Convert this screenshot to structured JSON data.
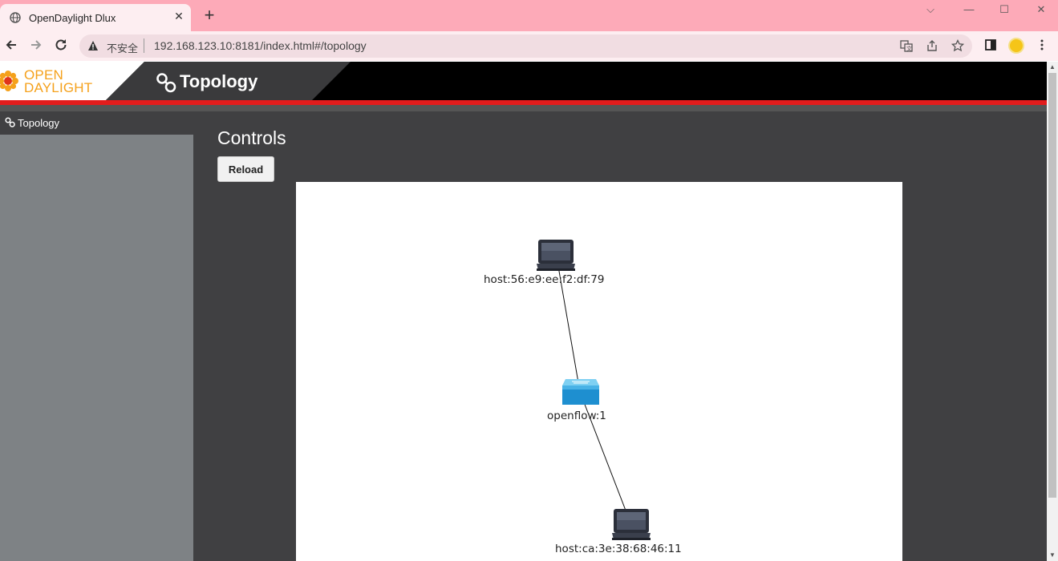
{
  "browser": {
    "tab_title": "OpenDaylight Dlux",
    "tab_close": "✕",
    "new_tab": "+",
    "insecure_label": "不安全",
    "url": "192.168.123.10:8181/index.html#/topology",
    "window_controls": {
      "chevron": "⌵",
      "minimize": "—",
      "maximize": "☐",
      "close": "✕"
    }
  },
  "app": {
    "logo_line1": "OPEN",
    "logo_line2": "DAYLIGHT",
    "header_title": "Topology",
    "sidebar_item": "Topology",
    "controls_title": "Controls",
    "reload_label": "Reload"
  },
  "topology": {
    "nodes": [
      {
        "id": "host-1",
        "label": "host:56:e9:ee:f2:df:79",
        "type": "host"
      },
      {
        "id": "switch-1",
        "label": "openflow:1",
        "type": "switch"
      },
      {
        "id": "host-2",
        "label": "host:ca:3e:38:68:46:11",
        "type": "host"
      }
    ],
    "links": [
      {
        "from": "host:56:e9:ee:f2:df:79",
        "to": "openflow:1"
      },
      {
        "from": "openflow:1",
        "to": "host:ca:3e:38:68:46:11"
      }
    ]
  },
  "colors": {
    "accent_red": "#e21c1c",
    "logo_orange": "#f5a11b",
    "tab_pink": "#fdaab8"
  }
}
